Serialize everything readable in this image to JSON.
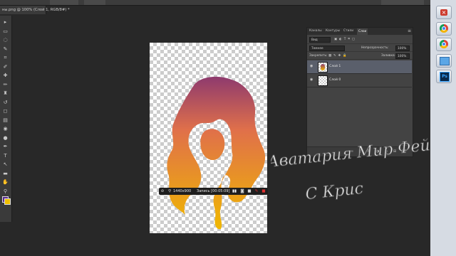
{
  "document_tab": {
    "title": "ны.png @ 100% (Слой 1, RGB/8#) *",
    "close": "×"
  },
  "toolbar": {
    "tools": [
      "move-tool",
      "marquee-tool",
      "lasso-tool",
      "quick-select-tool",
      "crop-tool",
      "eyedropper-tool",
      "healing-tool",
      "brush-tool",
      "stamp-tool",
      "history-brush-tool",
      "eraser-tool",
      "gradient-tool",
      "blur-tool",
      "dodge-tool",
      "pen-tool",
      "type-tool",
      "path-select-tool",
      "shape-tool",
      "hand-tool",
      "zoom-tool"
    ],
    "glyphs": [
      "▸",
      "▭",
      "◌",
      "✎",
      "⌗",
      "✐",
      "✚",
      "✏",
      "♜",
      "↺",
      "◻",
      "▤",
      "◉",
      "●",
      "✒",
      "T",
      "↖",
      "▬",
      "✋",
      "⚲"
    ],
    "fg_color": "#5a2a8a",
    "bg_color": "#f0c000"
  },
  "layers_panel": {
    "tabs": [
      "Каналы",
      "Контуры",
      "Стили",
      "Слои"
    ],
    "active_tab": "Слои",
    "menu": "≡",
    "kind_filter": "Вид",
    "blend_mode": "Темнее",
    "opacity_label": "Непрозрачность:",
    "opacity_value": "100%",
    "lock_label": "Закрепить:",
    "fill_label": "Заливка:",
    "fill_value": "100%",
    "layers": [
      {
        "name": "Слой 1",
        "selected": true,
        "visible": true
      },
      {
        "name": "Слой 0",
        "selected": false,
        "visible": true
      }
    ]
  },
  "recording": {
    "resolution": "1440x900",
    "status": "Запись [00:05:09]"
  },
  "watermark": {
    "line1": "Авaтария Мир Фей",
    "line2": "С Крис"
  },
  "right_strip": {
    "icons": [
      "close-icon",
      "chrome-icon",
      "chrome-icon",
      "paint-app-icon",
      "photoshop-icon"
    ],
    "ps_label": "Ps"
  },
  "colors": {
    "hair_top": "#8e3a6e",
    "hair_mid": "#e0704a",
    "hair_bottom": "#f0b800",
    "accent": "#3b6fbf"
  }
}
